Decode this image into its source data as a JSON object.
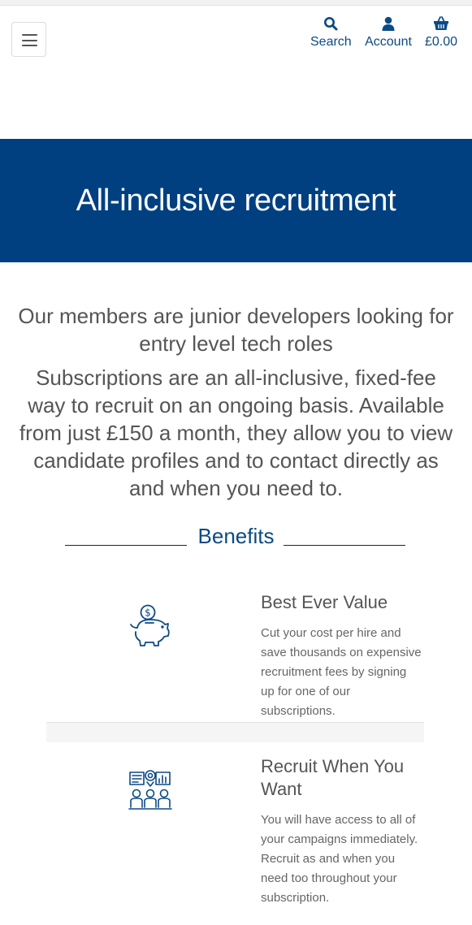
{
  "header": {
    "search_label": "Search",
    "account_label": "Account",
    "basket_label": "£0.00",
    "accent_color": "#0b4a85",
    "icons": {
      "menu": "hamburger-icon",
      "search": "search-icon",
      "account": "user-icon",
      "basket": "basket-icon"
    }
  },
  "hero": {
    "title": "All-inclusive recruitment",
    "background": "#004080"
  },
  "intro": {
    "lead": "Our members are junior developers looking for entry level tech roles",
    "body": "Subscriptions are an all-inclusive, fixed-fee way to recruit on an ongoing basis. Available from just £150 a month, they allow you to view candidate profiles and to contact directly as and when you need to."
  },
  "benefits": {
    "heading": "Benefits",
    "items": [
      {
        "icon": "piggy-bank-icon",
        "title": "Best Ever Value",
        "text": "Cut your cost per hire and save thousands on expensive recruitment fees by signing up for one of our subscriptions."
      },
      {
        "icon": "team-dashboard-icon",
        "title": "Recruit When You Want",
        "text": "You will have access to all of your campaigns immediately. Recruit as and when you need too throughout your subscription."
      }
    ]
  }
}
